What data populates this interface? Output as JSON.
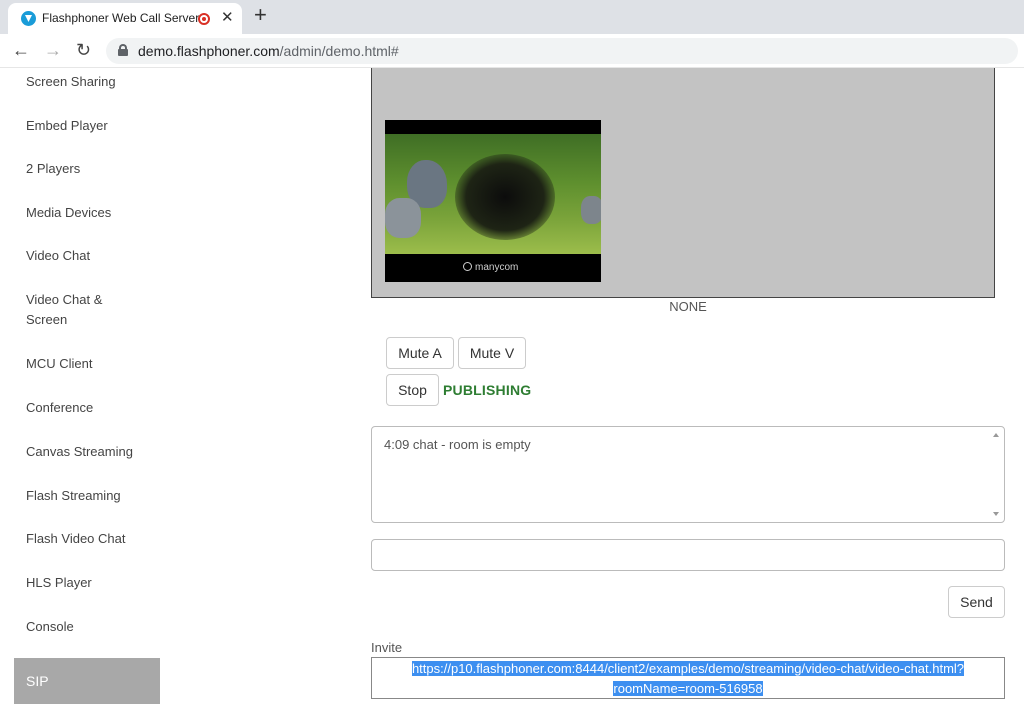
{
  "browser": {
    "tab_title": "Flashphoner Web Call Server",
    "tab_close": "✕",
    "new_tab": "+",
    "back": "←",
    "forward": "→",
    "reload": "↻",
    "url_host": "demo.flashphoner.com",
    "url_path": "/admin/demo.html#"
  },
  "sidebar": {
    "items": [
      {
        "label": "Screen Sharing"
      },
      {
        "label": "Embed Player"
      },
      {
        "label": "2 Players"
      },
      {
        "label": "Media Devices"
      },
      {
        "label": "Video Chat"
      },
      {
        "label": "Video Chat & Screen"
      },
      {
        "label": "MCU Client"
      },
      {
        "label": "Conference"
      },
      {
        "label": "Canvas Streaming"
      },
      {
        "label": "Flash Streaming"
      },
      {
        "label": "Flash Video Chat"
      },
      {
        "label": "HLS Player"
      },
      {
        "label": "Console"
      }
    ],
    "active_item": "SIP"
  },
  "main": {
    "video_logo": "manycom",
    "remote_status": "NONE",
    "mute_audio_label": "Mute A",
    "mute_video_label": "Mute V",
    "stop_label": "Stop",
    "publish_status": "PUBLISHING",
    "publish_status_color": "#2e7d32",
    "chat_log": "4:09 chat - room is empty",
    "chat_input_value": "",
    "send_label": "Send",
    "invite_label": "Invite",
    "invite_url_line1": "https://p10.flashphoner.com:8444/client2/examples/demo/streaming/video-chat/video-chat.html?",
    "invite_url_line2": "roomName=room-516958",
    "selection_color": "#3d8ff0"
  }
}
